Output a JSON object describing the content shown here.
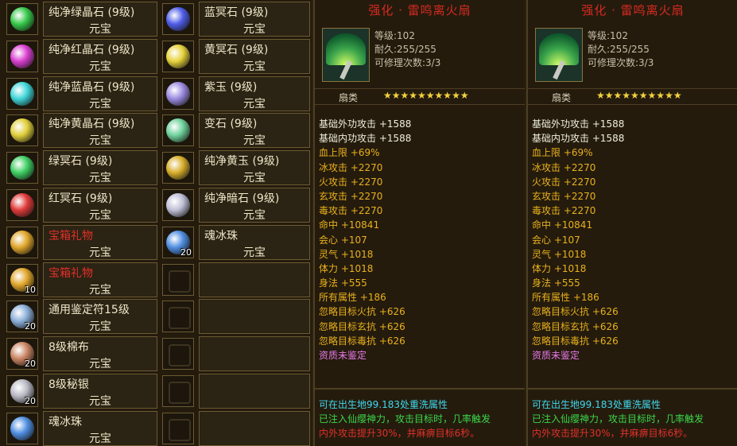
{
  "left_grid": {
    "col1": [
      {
        "name": "纯净绿晶石 (9级)",
        "unit": "元宝",
        "gem_color": "#37c94a",
        "name_color": "normal",
        "count": ""
      },
      {
        "name": "纯净红晶石 (9级)",
        "unit": "元宝",
        "gem_color": "#d93fd0",
        "name_color": "normal",
        "count": ""
      },
      {
        "name": "纯净蓝晶石 (9级)",
        "unit": "元宝",
        "gem_color": "#3fd6d9",
        "name_color": "normal",
        "count": ""
      },
      {
        "name": "纯净黄晶石 (9级)",
        "unit": "元宝",
        "gem_color": "#e0cf3a",
        "name_color": "normal",
        "count": ""
      },
      {
        "name": "绿冥石 (9级)",
        "unit": "元宝",
        "gem_color": "#3fcf63",
        "name_color": "normal",
        "count": ""
      },
      {
        "name": "红冥石 (9级)",
        "unit": "元宝",
        "gem_color": "#e03a3a",
        "name_color": "normal",
        "count": ""
      },
      {
        "name": "宝箱礼物",
        "unit": "元宝",
        "gem_color": "#e0a62a",
        "name_color": "red",
        "count": ""
      },
      {
        "name": "宝箱礼物",
        "unit": "元宝",
        "gem_color": "#e0a62a",
        "name_color": "red",
        "count": "10"
      },
      {
        "name": "通用鉴定符15级",
        "unit": "元宝",
        "gem_color": "#8aaed8",
        "name_color": "normal",
        "count": "20"
      },
      {
        "name": "8级棉布",
        "unit": "元宝",
        "gem_color": "#c98463",
        "name_color": "normal",
        "count": "20"
      },
      {
        "name": "8级秘银",
        "unit": "元宝",
        "gem_color": "#b9b9c4",
        "name_color": "normal",
        "count": "20"
      },
      {
        "name": "魂冰珠",
        "unit": "元宝",
        "gem_color": "#4f8ee0",
        "name_color": "normal",
        "count": ""
      }
    ],
    "col2": [
      {
        "name": "蓝冥石 (9级)",
        "unit": "元宝",
        "gem_color": "#4f5de8",
        "name_color": "normal",
        "count": ""
      },
      {
        "name": "黄冥石 (9级)",
        "unit": "元宝",
        "gem_color": "#e7d23b",
        "name_color": "normal",
        "count": ""
      },
      {
        "name": "紫玉 (9级)",
        "unit": "元宝",
        "gem_color": "#9b8be0",
        "name_color": "normal",
        "count": ""
      },
      {
        "name": "变石 (9级)",
        "unit": "元宝",
        "gem_color": "#6fd29c",
        "name_color": "normal",
        "count": ""
      },
      {
        "name": "纯净黄玉 (9级)",
        "unit": "元宝",
        "gem_color": "#d8ae2a",
        "name_color": "normal",
        "count": ""
      },
      {
        "name": "纯净暗石 (9级)",
        "unit": "元宝",
        "gem_color": "#bfbfd6",
        "name_color": "normal",
        "count": ""
      },
      {
        "name": "魂冰珠",
        "unit": "元宝",
        "gem_color": "#4f8ee0",
        "name_color": "normal",
        "count": "20"
      }
    ]
  },
  "panels": [
    {
      "title": "强化 · 雷鸣离火扇",
      "level": "等级:102",
      "durability": "耐久:255/255",
      "repairs": "可修理次数:3/3",
      "type_label": "扇类",
      "stars": "★★★★★★★★★★",
      "stats": [
        {
          "label": "基础外功攻击",
          "value": "+1588",
          "style": "white"
        },
        {
          "label": "基础内功攻击",
          "value": "+1588",
          "style": "white"
        },
        {
          "label": "血上限",
          "value": "+69%",
          "style": "gold"
        },
        {
          "label": "冰攻击",
          "value": "+2270",
          "style": "gold"
        },
        {
          "label": "火攻击",
          "value": "+2270",
          "style": "gold"
        },
        {
          "label": "玄攻击",
          "value": "+2270",
          "style": "gold"
        },
        {
          "label": "毒攻击",
          "value": "+2270",
          "style": "gold"
        },
        {
          "label": "命中",
          "value": "+10841",
          "style": "gold"
        },
        {
          "label": "会心",
          "value": "+107",
          "style": "gold"
        },
        {
          "label": "灵气",
          "value": "+1018",
          "style": "gold"
        },
        {
          "label": "体力",
          "value": "+1018",
          "style": "gold"
        },
        {
          "label": "身法",
          "value": "+555",
          "style": "gold"
        },
        {
          "label": "所有属性",
          "value": "+186",
          "style": "gold"
        },
        {
          "label": "忽略目标火抗",
          "value": "+626",
          "style": "gold"
        },
        {
          "label": "忽略目标玄抗",
          "value": "+626",
          "style": "gold"
        },
        {
          "label": "忽略目标毒抗",
          "value": "+626",
          "style": "gold"
        },
        {
          "label": "资质未鉴定",
          "value": "",
          "style": "pink"
        }
      ],
      "foot1": "可在出生地99.183处重洗属性",
      "foot2": "已注入仙缨神力，攻击目标时，几率触发",
      "foot3": "内外攻击提升30%，并麻痹目标6秒。"
    },
    {
      "title": "强化 · 雷鸣离火扇",
      "level": "等级:102",
      "durability": "耐久:255/255",
      "repairs": "可修理次数:3/3",
      "type_label": "扇类",
      "stars": "★★★★★★★★★★",
      "stats": [
        {
          "label": "基础外功攻击",
          "value": "+1588",
          "style": "white"
        },
        {
          "label": "基础内功攻击",
          "value": "+1588",
          "style": "white"
        },
        {
          "label": "血上限",
          "value": "+69%",
          "style": "gold"
        },
        {
          "label": "冰攻击",
          "value": "+2270",
          "style": "gold"
        },
        {
          "label": "火攻击",
          "value": "+2270",
          "style": "gold"
        },
        {
          "label": "玄攻击",
          "value": "+2270",
          "style": "gold"
        },
        {
          "label": "毒攻击",
          "value": "+2270",
          "style": "gold"
        },
        {
          "label": "命中",
          "value": "+10841",
          "style": "gold"
        },
        {
          "label": "会心",
          "value": "+107",
          "style": "gold"
        },
        {
          "label": "灵气",
          "value": "+1018",
          "style": "gold"
        },
        {
          "label": "体力",
          "value": "+1018",
          "style": "gold"
        },
        {
          "label": "身法",
          "value": "+555",
          "style": "gold"
        },
        {
          "label": "所有属性",
          "value": "+186",
          "style": "gold"
        },
        {
          "label": "忽略目标火抗",
          "value": "+626",
          "style": "gold"
        },
        {
          "label": "忽略目标玄抗",
          "value": "+626",
          "style": "gold"
        },
        {
          "label": "忽略目标毒抗",
          "value": "+626",
          "style": "gold"
        },
        {
          "label": "资质未鉴定",
          "value": "",
          "style": "pink"
        }
      ],
      "foot1": "可在出生地99.183处重洗属性",
      "foot2": "已注入仙缨神力，攻击目标时，几率触发",
      "foot3": "内外攻击提升30%，并麻痹目标6秒。"
    }
  ],
  "empty_slot_count": 5
}
